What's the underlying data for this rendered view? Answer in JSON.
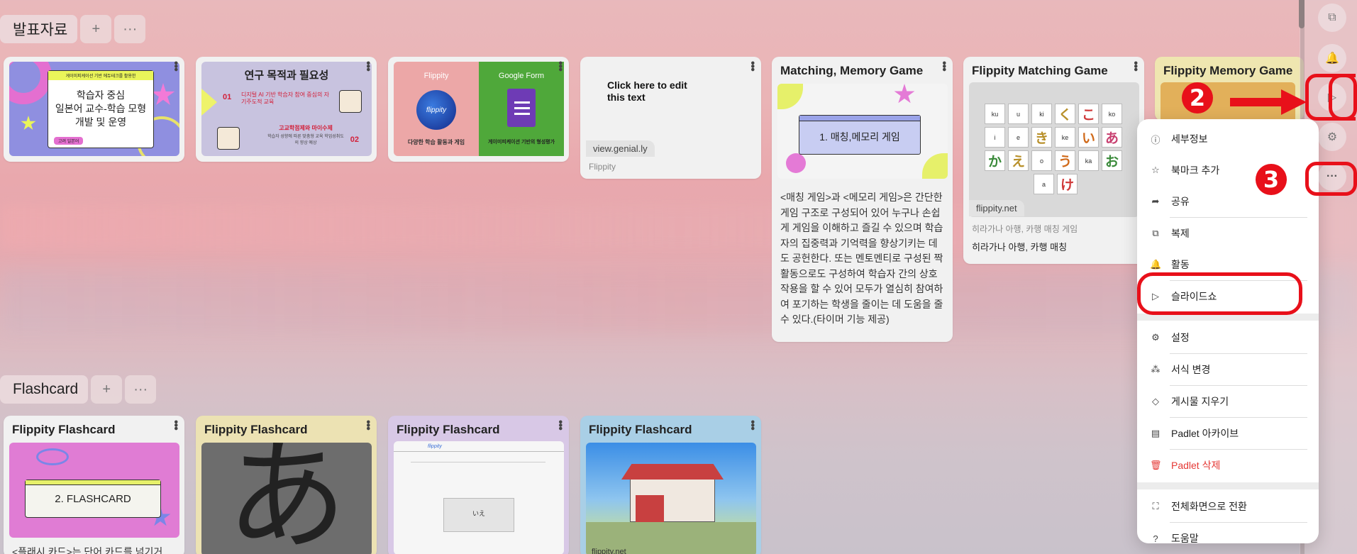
{
  "sections": [
    {
      "title": "발표자료",
      "add": "+",
      "more": "···"
    },
    {
      "title": "Flashcard",
      "add": "+",
      "more": "···"
    }
  ],
  "cards_row1": [
    {
      "thumb_lines": [
        "학습자 중심",
        "일본어 교수-학습 모형",
        "개발 및 운영"
      ],
      "thumb_header": "게이미피케이션 기반 에듀테크를 활용한",
      "thumb_footer": "고려 일본어"
    },
    {
      "thumb_title": "연구 목적과 필요성",
      "num1": "01",
      "text1": "디지털 AI 기반 학습자 참여 중심의 자기주도적 교육",
      "num2": "02",
      "text2": "고교학점제와 마이수제",
      "text2b": "학습자 성향에 따른 맞춤형 교육 학업성취도의 향상 예상"
    },
    {
      "left_brand": "Flippity",
      "left_caption": "다양한 학습 활동과 게임",
      "right_brand": "Google Form",
      "right_caption": "게이미피케이션 기반의 형성평가",
      "logo_text": "flippity"
    },
    {
      "thumb_text": "Click here to edit this text",
      "link": "view.genial.ly",
      "source": "Flippity"
    },
    {
      "title": "Matching, Memory Game",
      "thumb_label": "1. 매칭,메모리 게임",
      "body": "<매칭 게임>과 <메모리 게임>은 간단한 게임 구조로 구성되어 있어 누구나 손쉽게 게임을 이해하고 즐길 수 있으며 학습자의 집중력과 기억력을 향상기키는 데도 공헌한다. 또는 멘토멘티로 구성된 짝 활동으로도 구성하여 학습자 간의 상호작용을 할 수 있어 모두가 열심히 참여하여 포기하는 학생을 줄이는 데 도움을 줄 수 있다.(타이머 기능 제공)"
    },
    {
      "title": "Flippity Matching Game",
      "link": "flippity.net",
      "sub": "히라가나 아행, 카행 매칭 게임",
      "body": "히라가나 아행, 카행 매칭",
      "tiles": [
        [
          "ku",
          "u",
          "ki",
          "く",
          "こ",
          "ko"
        ],
        [
          "i",
          "e",
          "き",
          "ke",
          "い",
          "あ"
        ],
        [
          "か",
          "え",
          "o",
          "う",
          "ka",
          "お"
        ],
        [
          "a",
          "け"
        ]
      ]
    },
    {
      "title": "Flippity Memory Game"
    }
  ],
  "cards_row2": [
    {
      "title": "Flippity Flashcard",
      "thumb_label": "2. FLASHCARD",
      "body": "<플래시 카드>는 단어 카드를 넘기거"
    },
    {
      "title": "Flippity Flashcard",
      "glyph": "あ"
    },
    {
      "title": "Flippity Flashcard",
      "mini_brand": "flippity",
      "mini_word": "いえ"
    },
    {
      "title": "Flippity Flashcard",
      "link": "flippity.net"
    }
  ],
  "menu": [
    {
      "icon": "ⓘ",
      "label": "세부정보",
      "name": "menu-details"
    },
    {
      "icon": "☆",
      "label": "북마크 추가",
      "name": "menu-add-bookmark"
    },
    {
      "icon": "➦",
      "label": "공유",
      "name": "menu-share"
    },
    {
      "icon": "⧉",
      "label": "복제",
      "name": "menu-duplicate"
    },
    {
      "icon": "🔔",
      "label": "활동",
      "name": "menu-activity"
    },
    {
      "icon": "▷",
      "label": "슬라이드쇼",
      "name": "menu-slideshow"
    },
    {
      "icon": "⚙",
      "label": "설정",
      "name": "menu-settings"
    },
    {
      "icon": "⁂",
      "label": "서식 변경",
      "name": "menu-remake"
    },
    {
      "icon": "◇",
      "label": "게시물 지우기",
      "name": "menu-clear-posts"
    },
    {
      "icon": "▤",
      "label": "Padlet 아카이브",
      "name": "menu-archive"
    },
    {
      "icon": "🗑",
      "label": "Padlet 삭제",
      "name": "menu-delete",
      "danger": true
    },
    {
      "icon": "⛶",
      "label": "전체화면으로 전환",
      "name": "menu-fullscreen"
    },
    {
      "icon": "?",
      "label": "도움말",
      "name": "menu-help"
    }
  ],
  "rail": {
    "remake": "⧉",
    "bell": "🔔",
    "play": "▷",
    "gear": "⚙",
    "more": "···"
  },
  "annotations": {
    "badge2": "2",
    "badge3": "3"
  },
  "colors": {
    "accent_red": "#e8101a",
    "danger": "#e53935"
  }
}
